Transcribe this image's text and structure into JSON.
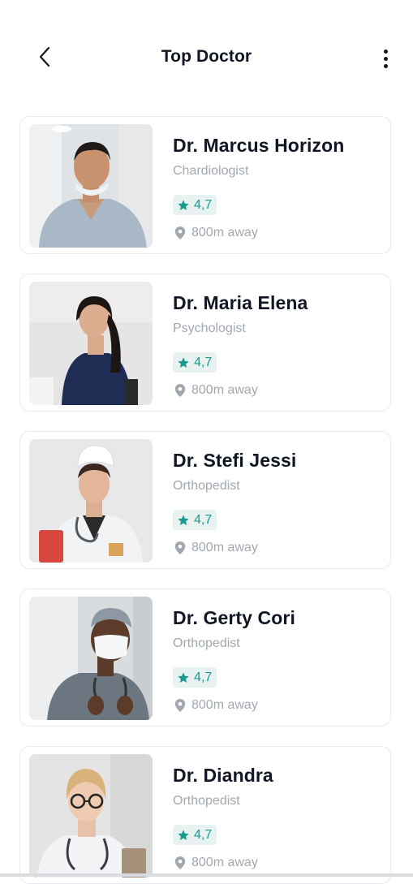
{
  "header": {
    "title": "Top Doctor",
    "back_icon": "chevron-left-icon",
    "more_icon": "more-vertical-icon"
  },
  "colors": {
    "accent": "#199a8e",
    "accent_bg": "#e8f3f1",
    "muted_text": "#a1a8b0",
    "primary_text": "#101623",
    "card_border": "#e8eaed"
  },
  "doctors": [
    {
      "name": "Dr. Marcus Horizon",
      "specialty": "Chardiologist",
      "rating": "4,7",
      "distance": "800m away"
    },
    {
      "name": "Dr. Maria Elena",
      "specialty": "Psychologist",
      "rating": "4,7",
      "distance": "800m away"
    },
    {
      "name": "Dr. Stefi Jessi",
      "specialty": "Orthopedist",
      "rating": "4,7",
      "distance": "800m away"
    },
    {
      "name": "Dr. Gerty Cori",
      "specialty": "Orthopedist",
      "rating": "4,7",
      "distance": "800m away"
    },
    {
      "name": "Dr. Diandra",
      "specialty": "Orthopedist",
      "rating": "4,7",
      "distance": "800m away"
    }
  ]
}
